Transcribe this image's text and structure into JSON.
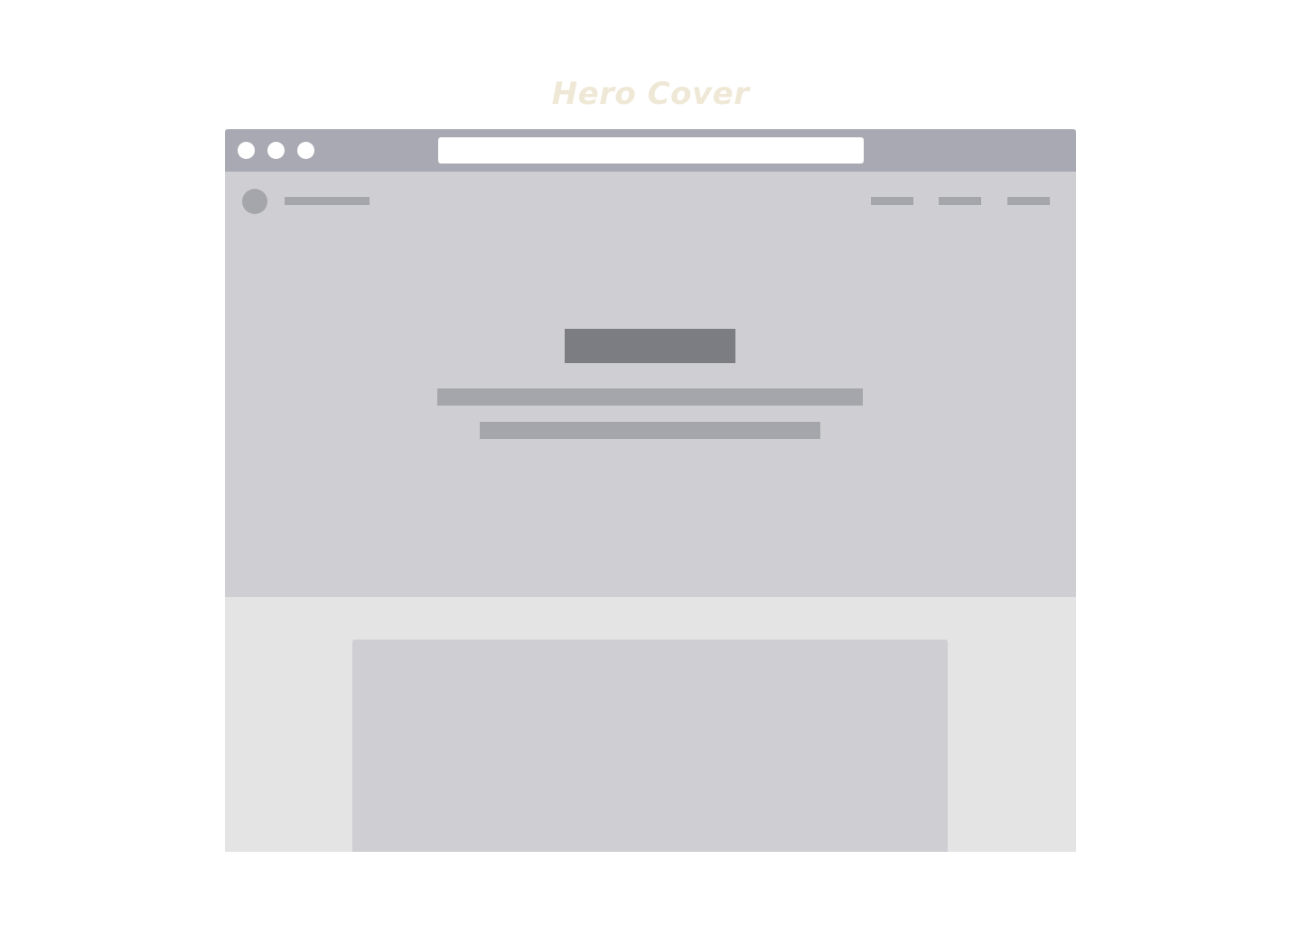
{
  "caption": {
    "text": "Hero Cover",
    "color": "#efe8d6"
  },
  "colors": {
    "titlebar": "#a8a9b3",
    "window_dots": "#ffffff",
    "url_bar": "#ffffff",
    "hero_background": "#cfced3",
    "logo_placeholder": "#a5a6ab",
    "nav_placeholder": "#a5a6ab",
    "heading_placeholder": "#7b7d82",
    "text_placeholder": "#a5a6ab",
    "content_background": "#e4e4e4",
    "card_background": "#cfced3"
  },
  "window_controls": [
    {
      "name": "window-dot-1"
    },
    {
      "name": "window-dot-2"
    },
    {
      "name": "window-dot-3"
    }
  ],
  "nav": {
    "item_count": 3
  },
  "hero": {
    "paragraph_lines": 2
  }
}
